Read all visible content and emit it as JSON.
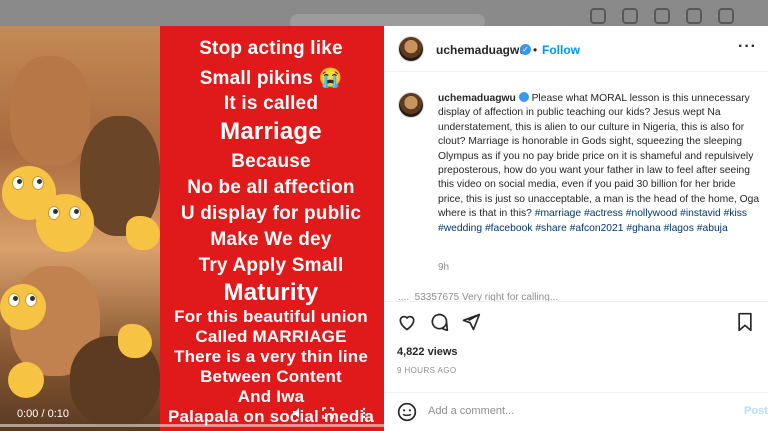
{
  "video": {
    "caption_lines": [
      "Stop acting like",
      "Small pikins 😭",
      "It is called",
      "Marriage",
      "Because",
      "No be all affection",
      "U display for public",
      "Make We dey",
      "Try Apply  Small",
      "Maturity",
      "For this beautiful union",
      "Called MARRIAGE",
      "There is a very thin line",
      "Between Content",
      "And Iwa",
      "Palapala on social media"
    ],
    "time": "0:00 / 0:10",
    "progress": 0
  },
  "post": {
    "username": "uchemaduagwu",
    "verified_mark": "✓",
    "follow_label": "Follow",
    "dot": "•",
    "more": "···",
    "comment_text": "Please what MORAL lesson is this unnecessary display of affection in public teaching our kids? Jesus wept Na understatement, this is alien to our culture in Nigeria, this is also for clout? Marriage is honorable in Gods sight, squeezing the sleeping Olympus as if you no pay bride price on it is shameful and repulsively preposterous, how do you want your father in law to feel after seeing this video on social media, even if you paid 30 billion for her bride price, this is just so unacceptable, a man is the head of the home, Oga where is that in this?",
    "hashtags": "#marriage #actress #nollywood #instavid #kiss #wedding #facebook #share #afcon2021 #ghana #lagos #abuja",
    "comment_age": "9h",
    "next_comment_peek": "...._53357675  Very right for calling...",
    "views": "4,822 views",
    "posted_ago": "9 HOURS AGO",
    "add_comment_placeholder": "Add a comment...",
    "post_label": "Post"
  },
  "colors": {
    "video_bg": "#e01a1a",
    "link": "#0095f6",
    "hashtag": "#00376b"
  },
  "icons": [
    "heart-icon",
    "comment-icon",
    "share-icon",
    "bookmark-icon",
    "emoji-icon",
    "more-icon",
    "volume-icon",
    "fullscreen-icon",
    "options-icon"
  ]
}
